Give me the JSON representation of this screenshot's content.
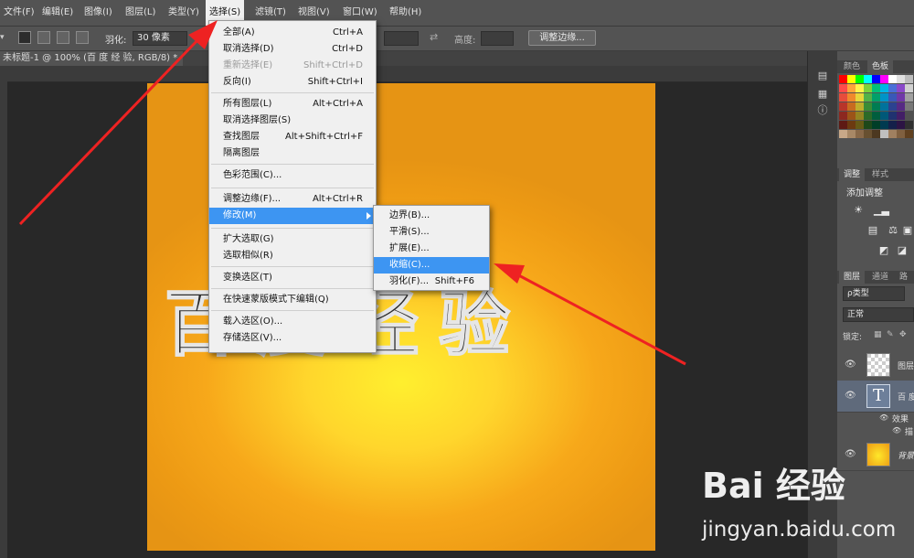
{
  "menubar": {
    "items": [
      "文件(F)",
      "编辑(E)",
      "图像(I)",
      "图层(L)",
      "类型(Y)",
      "选择(S)",
      "滤镜(T)",
      "视图(V)",
      "窗口(W)",
      "帮助(H)"
    ]
  },
  "options": {
    "feather_label": "羽化:",
    "feather_value": "30 像素",
    "height_label": "高度:",
    "refine_edge_button": "调整边缘..."
  },
  "document": {
    "tab_title": "未标题-1 @ 100% (百 度 经 验, RGB/8) *",
    "canvas_text": "百度经验",
    "canvas_colors": [
      "#ffef2e",
      "#ed9a14"
    ]
  },
  "select_menu": {
    "items": [
      {
        "label": "全部(A)",
        "shortcut": "Ctrl+A",
        "disabled": false
      },
      {
        "label": "取消选择(D)",
        "shortcut": "Ctrl+D",
        "disabled": false
      },
      {
        "label": "重新选择(E)",
        "shortcut": "Shift+Ctrl+D",
        "disabled": true
      },
      {
        "label": "反向(I)",
        "shortcut": "Shift+Ctrl+I",
        "disabled": false
      },
      {
        "label": "所有图层(L)",
        "shortcut": "Alt+Ctrl+A",
        "disabled": false
      },
      {
        "label": "取消选择图层(S)",
        "shortcut": "",
        "disabled": false
      },
      {
        "label": "查找图层",
        "shortcut": "Alt+Shift+Ctrl+F",
        "disabled": false
      },
      {
        "label": "隔离图层",
        "shortcut": "",
        "disabled": false
      },
      {
        "label": "色彩范围(C)...",
        "shortcut": "",
        "disabled": false
      },
      {
        "label": "调整边缘(F)...",
        "shortcut": "Alt+Ctrl+R",
        "disabled": false
      },
      {
        "label": "修改(M)",
        "shortcut": "",
        "disabled": false,
        "highlighted": true
      },
      {
        "label": "扩大选取(G)",
        "shortcut": "",
        "disabled": false
      },
      {
        "label": "选取相似(R)",
        "shortcut": "",
        "disabled": false
      },
      {
        "label": "变换选区(T)",
        "shortcut": "",
        "disabled": false
      },
      {
        "label": "在快速蒙版模式下编辑(Q)",
        "shortcut": "",
        "disabled": false
      },
      {
        "label": "载入选区(O)...",
        "shortcut": "",
        "disabled": false
      },
      {
        "label": "存储选区(V)...",
        "shortcut": "",
        "disabled": false
      }
    ]
  },
  "modify_submenu": {
    "items": [
      {
        "label": "边界(B)...",
        "shortcut": ""
      },
      {
        "label": "平滑(S)...",
        "shortcut": ""
      },
      {
        "label": "扩展(E)...",
        "shortcut": ""
      },
      {
        "label": "收缩(C)...",
        "shortcut": "",
        "highlighted": true
      },
      {
        "label": "羽化(F)...",
        "shortcut": "Shift+F6"
      }
    ]
  },
  "panels": {
    "color_tabs": [
      "颜色",
      "色板"
    ],
    "adjust_tabs": [
      "调整",
      "样式"
    ],
    "adjust_title": "添加调整",
    "layers_tabs": [
      "图层",
      "通道",
      "路"
    ],
    "kind_filter": "ρ类型",
    "blend_mode": "正常",
    "lock_label": "锁定:",
    "layers": [
      {
        "name": "图层"
      },
      {
        "name": "百 度"
      },
      {
        "name": "效果"
      },
      {
        "name": "描"
      },
      {
        "name": "背景"
      }
    ],
    "swatch_colors": [
      "#ff0000",
      "#ffff00",
      "#00ff00",
      "#00ffff",
      "#0000ff",
      "#ff00ff",
      "#ffffff",
      "#e0e0e0",
      "#bcbcbc",
      "#ff4b4b",
      "#ffa53a",
      "#fff34a",
      "#7cd23b",
      "#00c078",
      "#00b6e6",
      "#4a6fd8",
      "#8a49c9",
      "#d0d0d0",
      "#e74c3c",
      "#f08a2c",
      "#e8d63a",
      "#52b248",
      "#00a06a",
      "#0094c8",
      "#3a58b8",
      "#7038a8",
      "#a0a0a0",
      "#b8352a",
      "#c86c20",
      "#c0ae2c",
      "#3a8c36",
      "#007c52",
      "#00729c",
      "#2c4290",
      "#562a84",
      "#787878",
      "#8c2820",
      "#9c5418",
      "#948422",
      "#2c6a28",
      "#005e3e",
      "#005878",
      "#203270",
      "#421e66",
      "#505050",
      "#5e1a14",
      "#6c3a10",
      "#665a16",
      "#1e481a",
      "#003e28",
      "#003a50",
      "#14204a",
      "#2c1444",
      "#303030",
      "#c8a888",
      "#a88866",
      "#886848",
      "#685030",
      "#4c3820",
      "#c0c0c0",
      "#a08060",
      "#806040",
      "#604020"
    ]
  },
  "watermark": {
    "logo_text": "Bai 经验",
    "url": "jingyan.baidu.com"
  },
  "annotation_color": "#ee2222"
}
